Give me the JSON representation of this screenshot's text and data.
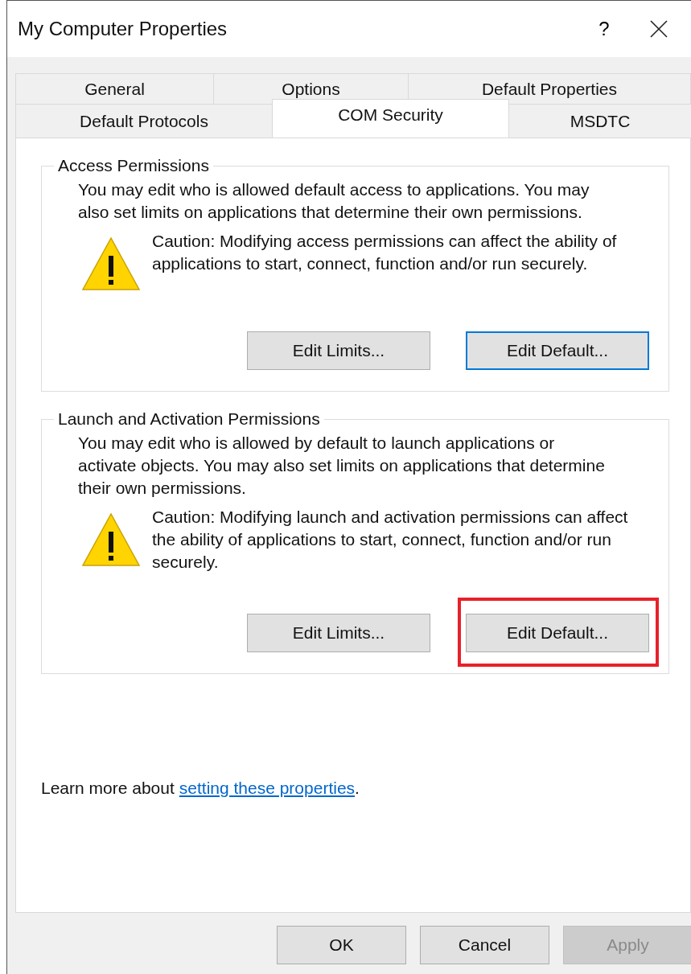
{
  "window": {
    "title": "My Computer Properties",
    "help": "?"
  },
  "tabs": [
    [
      {
        "label": "General",
        "selected": false
      },
      {
        "label": "Options",
        "selected": false
      },
      {
        "label": "Default Properties",
        "selected": false
      }
    ],
    [
      {
        "label": "Default Protocols",
        "selected": false
      },
      {
        "label": "COM Security",
        "selected": true
      },
      {
        "label": "MSDTC",
        "selected": false
      }
    ]
  ],
  "groups": [
    {
      "title": "Access Permissions",
      "description": "You may edit who is allowed default access to applications. You may also set limits on applications that determine their own permissions.",
      "caution": "Caution: Modifying access permissions can affect the ability of applications to start, connect, function and/or run securely.",
      "buttons": [
        {
          "label": "Edit Limits...",
          "focused": false,
          "highlighted": false
        },
        {
          "label": "Edit Default...",
          "focused": true,
          "highlighted": false
        }
      ]
    },
    {
      "title": "Launch and Activation Permissions",
      "description": "You may edit who is allowed by default to launch applications or activate objects. You may also set limits on applications that determine their own permissions.",
      "caution": "Caution: Modifying launch and activation permissions can affect the ability of applications to start, connect, function and/or run securely.",
      "buttons": [
        {
          "label": "Edit Limits...",
          "focused": false,
          "highlighted": false
        },
        {
          "label": "Edit Default...",
          "focused": false,
          "highlighted": true
        }
      ]
    }
  ],
  "learn_more": {
    "text": "Learn more about",
    "link": "setting these properties",
    "suffix": "."
  },
  "footer_buttons": [
    {
      "label": "OK",
      "disabled": false
    },
    {
      "label": "Cancel",
      "disabled": false
    },
    {
      "label": "Apply",
      "disabled": true
    }
  ]
}
